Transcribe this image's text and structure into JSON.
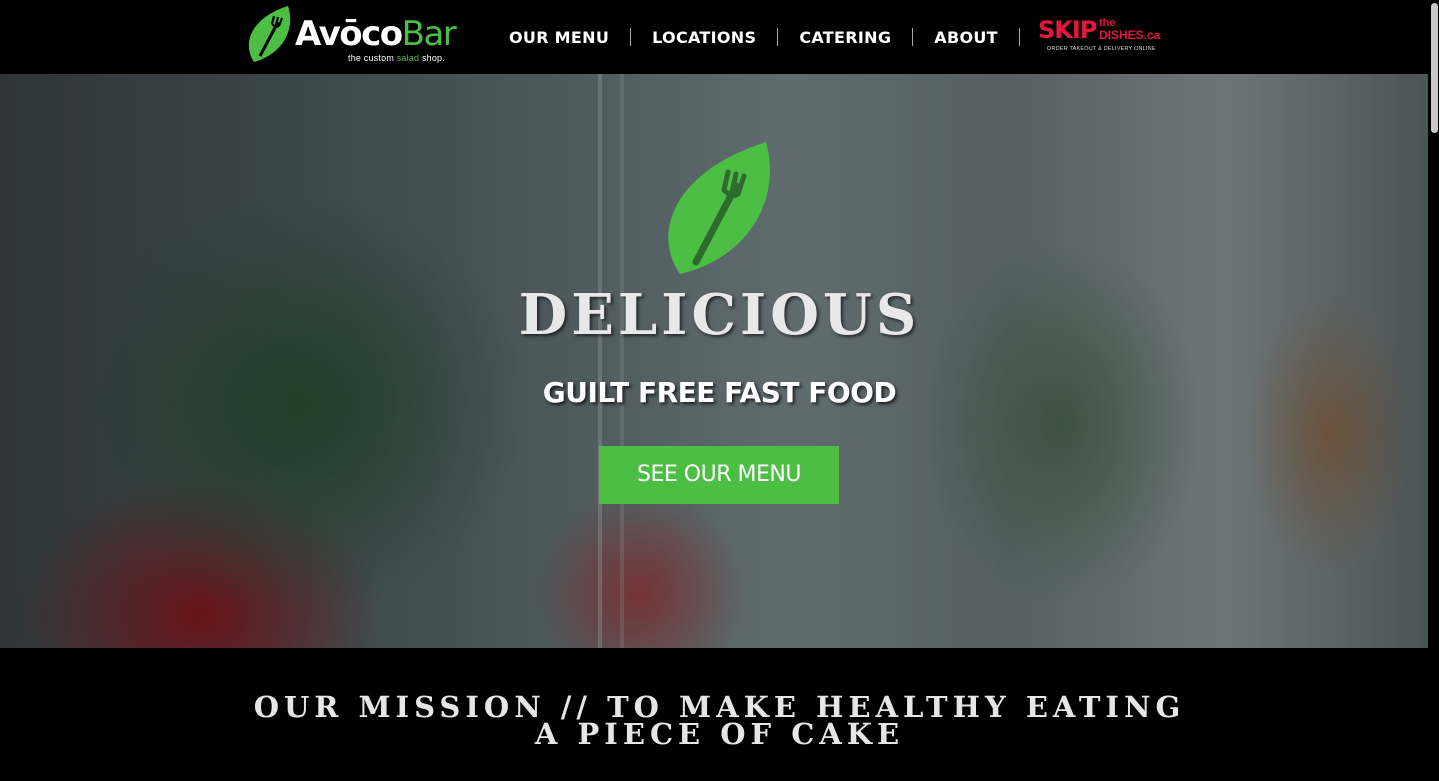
{
  "header": {
    "logo": {
      "name_part1": "Avōco",
      "name_part2": "Bar",
      "tagline_pre": "the custom ",
      "tagline_green": "salad",
      "tagline_post": " shop."
    },
    "nav": [
      {
        "label": "OUR MENU"
      },
      {
        "label": "LOCATIONS"
      },
      {
        "label": "CATERING"
      },
      {
        "label": "ABOUT"
      }
    ],
    "skip": {
      "main": "SKIP",
      "the": "the",
      "dishes": "DISHES.ca",
      "sub": "ORDER TAKEOUT & DELIVERY ONLINE"
    }
  },
  "hero": {
    "title": "DELICIOUS",
    "subtitle": "GUILT FREE FAST FOOD",
    "cta_label": "SEE OUR MENU"
  },
  "mission": {
    "line1": "OUR MISSION // TO MAKE HEALTHY EATING",
    "line2": "A PIECE OF CAKE"
  },
  "colors": {
    "brand_green": "#4cbe44",
    "skip_red": "#e2173e",
    "background": "#000000"
  },
  "icons": {
    "logo": "leaf-fork-icon",
    "hero": "leaf-fork-icon"
  }
}
